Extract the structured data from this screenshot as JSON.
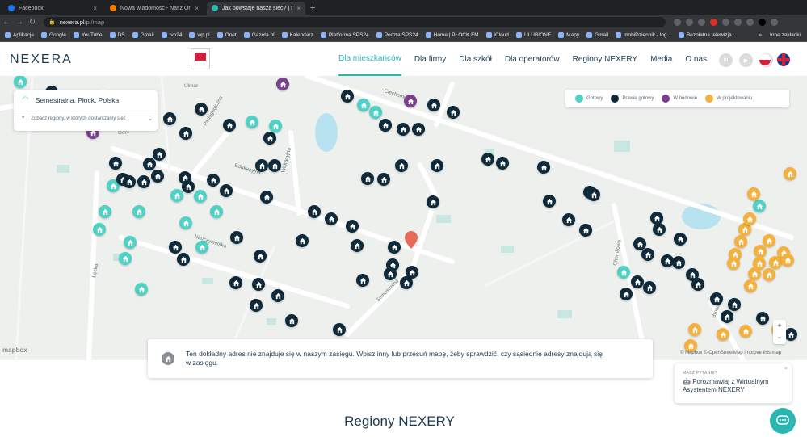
{
  "browser": {
    "tabs": [
      {
        "title": "Facebook",
        "color": "#1877f2",
        "active": false
      },
      {
        "title": "Nowa wiadomość - Nasz Orange",
        "color": "#ff7900",
        "active": false
      },
      {
        "title": "Jak powstaje nasza sieć? | Nexera",
        "color": "#2bb6b0",
        "active": true
      }
    ],
    "new_tab": "+",
    "url_host": "nexera.pl",
    "url_path": "/pl/map",
    "bookmarks": [
      "Aplikacje",
      "Google",
      "YouTube",
      "DS",
      "Gmail",
      "tvn24",
      "wp.pl",
      "Onet",
      "Gazeta.pl",
      "Kalendarz",
      "Platforma SPS24",
      "Poczta SPS24",
      "Home | PŁOCK FM",
      "iCloud",
      "ULUBIONE",
      "Mapy",
      "Gmail",
      "mobiDziennik - log...",
      "Bezpłatna telewizja..."
    ],
    "bookmarks_more": "»",
    "other_bookmarks": "Inne zakładki"
  },
  "site": {
    "logo": "NEXERA",
    "nav": [
      {
        "label": "Dla mieszkańców",
        "active": true
      },
      {
        "label": "Dla firmy",
        "active": false
      },
      {
        "label": "Dla szkół",
        "active": false
      },
      {
        "label": "Dla operatorów",
        "active": false
      },
      {
        "label": "Regiony NEXERY",
        "active": false
      },
      {
        "label": "Media",
        "active": false
      },
      {
        "label": "O nas",
        "active": false
      }
    ],
    "social": [
      "in",
      "▶",
      "f"
    ]
  },
  "map": {
    "search_value": "Semestralna, Płock, Polska",
    "regions_link": "Zobacz regiony, w których dostarczamy sieć",
    "legend": [
      {
        "label": "Gotowy",
        "color": "#4fd1c5"
      },
      {
        "label": "Prawie gotowy",
        "color": "#0f2a3a"
      },
      {
        "label": "W budowie",
        "color": "#7a3f8f"
      },
      {
        "label": "W projektowaniu",
        "color": "#f5b13d"
      }
    ],
    "street_labels": [
      "Ciechomicka",
      "Edukacyjna",
      "Wakacyjna",
      "Pedagogiczna",
      "Nauczycielska",
      "Semestralna",
      "Łęcka",
      "Chemiłowa",
      "Browarna",
      "Ulmar",
      "Góry"
    ],
    "mapbox_logo": "mapbox",
    "attribution": "© Mapbox © OpenStreetMap Improve this map",
    "zoom_in": "+",
    "zoom_out": "−"
  },
  "info": {
    "message": "Ten dokładny adres nie znajduje się w naszym zasięgu. Wpisz inny lub przesuń mapę, żeby sprawdzić, czy sąsiednie adresy znajdują się w zasięgu."
  },
  "chat": {
    "small": "MASZ PYTANIE?",
    "text": "Porozmawiaj z Wirtualnym Asystentem NEXERY",
    "close": "×"
  },
  "section": {
    "title": "Regiony NEXERY"
  }
}
